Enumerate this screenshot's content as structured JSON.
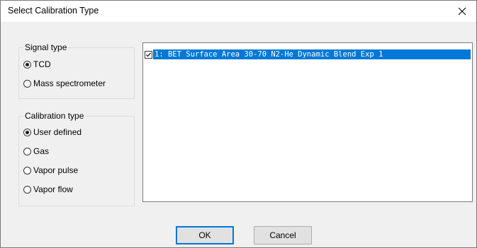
{
  "dialog": {
    "title": "Select Calibration Type",
    "close_glyph": "×"
  },
  "signal_type": {
    "label": "Signal type",
    "options": [
      {
        "label": "TCD",
        "checked": true
      },
      {
        "label": "Mass spectrometer",
        "checked": false
      }
    ]
  },
  "calibration_type": {
    "label": "Calibration type",
    "options": [
      {
        "label": "User defined",
        "checked": true
      },
      {
        "label": "Gas",
        "checked": false
      },
      {
        "label": "Vapor pulse",
        "checked": false
      },
      {
        "label": "Vapor flow",
        "checked": false
      }
    ]
  },
  "calibration_list": {
    "items": [
      {
        "label": "1: BET Surface Area 30-70 N2-He Dynamic Blend Exp 1",
        "checked": true,
        "selected": true
      }
    ]
  },
  "buttons": {
    "ok_label": "OK",
    "cancel_label": "Cancel"
  },
  "colors": {
    "selection": "#0078d7",
    "dialog_bg": "#f0f0f0",
    "titlebar_bg": "#ffffff",
    "default_button_border": "#0078d7"
  },
  "icons": {
    "close": "close-icon",
    "checkbox": "checkmark-icon"
  }
}
